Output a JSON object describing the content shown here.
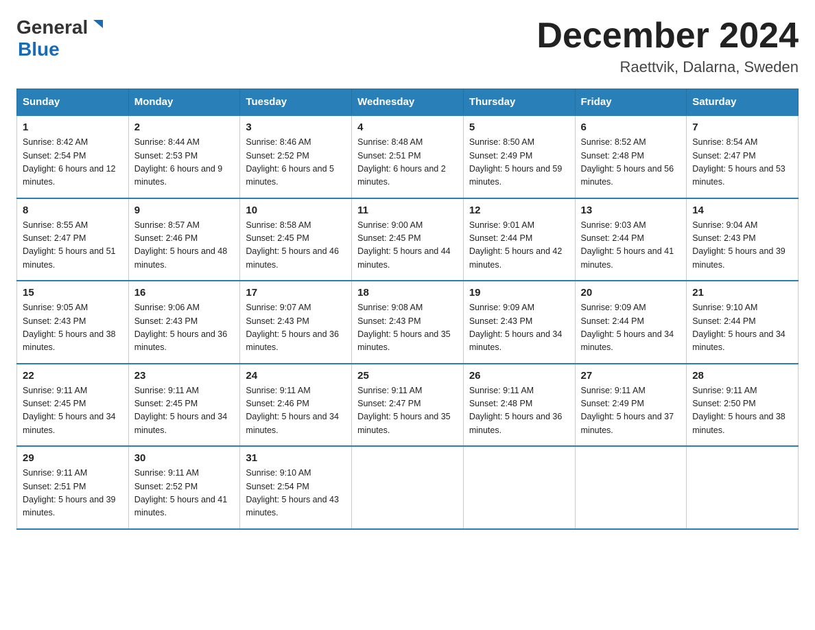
{
  "header": {
    "logo_general": "General",
    "logo_blue": "Blue",
    "month_title": "December 2024",
    "location": "Raettvik, Dalarna, Sweden"
  },
  "days_of_week": [
    "Sunday",
    "Monday",
    "Tuesday",
    "Wednesday",
    "Thursday",
    "Friday",
    "Saturday"
  ],
  "weeks": [
    [
      {
        "day": "1",
        "sunrise": "8:42 AM",
        "sunset": "2:54 PM",
        "daylight": "6 hours and 12 minutes."
      },
      {
        "day": "2",
        "sunrise": "8:44 AM",
        "sunset": "2:53 PM",
        "daylight": "6 hours and 9 minutes."
      },
      {
        "day": "3",
        "sunrise": "8:46 AM",
        "sunset": "2:52 PM",
        "daylight": "6 hours and 5 minutes."
      },
      {
        "day": "4",
        "sunrise": "8:48 AM",
        "sunset": "2:51 PM",
        "daylight": "6 hours and 2 minutes."
      },
      {
        "day": "5",
        "sunrise": "8:50 AM",
        "sunset": "2:49 PM",
        "daylight": "5 hours and 59 minutes."
      },
      {
        "day": "6",
        "sunrise": "8:52 AM",
        "sunset": "2:48 PM",
        "daylight": "5 hours and 56 minutes."
      },
      {
        "day": "7",
        "sunrise": "8:54 AM",
        "sunset": "2:47 PM",
        "daylight": "5 hours and 53 minutes."
      }
    ],
    [
      {
        "day": "8",
        "sunrise": "8:55 AM",
        "sunset": "2:47 PM",
        "daylight": "5 hours and 51 minutes."
      },
      {
        "day": "9",
        "sunrise": "8:57 AM",
        "sunset": "2:46 PM",
        "daylight": "5 hours and 48 minutes."
      },
      {
        "day": "10",
        "sunrise": "8:58 AM",
        "sunset": "2:45 PM",
        "daylight": "5 hours and 46 minutes."
      },
      {
        "day": "11",
        "sunrise": "9:00 AM",
        "sunset": "2:45 PM",
        "daylight": "5 hours and 44 minutes."
      },
      {
        "day": "12",
        "sunrise": "9:01 AM",
        "sunset": "2:44 PM",
        "daylight": "5 hours and 42 minutes."
      },
      {
        "day": "13",
        "sunrise": "9:03 AM",
        "sunset": "2:44 PM",
        "daylight": "5 hours and 41 minutes."
      },
      {
        "day": "14",
        "sunrise": "9:04 AM",
        "sunset": "2:43 PM",
        "daylight": "5 hours and 39 minutes."
      }
    ],
    [
      {
        "day": "15",
        "sunrise": "9:05 AM",
        "sunset": "2:43 PM",
        "daylight": "5 hours and 38 minutes."
      },
      {
        "day": "16",
        "sunrise": "9:06 AM",
        "sunset": "2:43 PM",
        "daylight": "5 hours and 36 minutes."
      },
      {
        "day": "17",
        "sunrise": "9:07 AM",
        "sunset": "2:43 PM",
        "daylight": "5 hours and 36 minutes."
      },
      {
        "day": "18",
        "sunrise": "9:08 AM",
        "sunset": "2:43 PM",
        "daylight": "5 hours and 35 minutes."
      },
      {
        "day": "19",
        "sunrise": "9:09 AM",
        "sunset": "2:43 PM",
        "daylight": "5 hours and 34 minutes."
      },
      {
        "day": "20",
        "sunrise": "9:09 AM",
        "sunset": "2:44 PM",
        "daylight": "5 hours and 34 minutes."
      },
      {
        "day": "21",
        "sunrise": "9:10 AM",
        "sunset": "2:44 PM",
        "daylight": "5 hours and 34 minutes."
      }
    ],
    [
      {
        "day": "22",
        "sunrise": "9:11 AM",
        "sunset": "2:45 PM",
        "daylight": "5 hours and 34 minutes."
      },
      {
        "day": "23",
        "sunrise": "9:11 AM",
        "sunset": "2:45 PM",
        "daylight": "5 hours and 34 minutes."
      },
      {
        "day": "24",
        "sunrise": "9:11 AM",
        "sunset": "2:46 PM",
        "daylight": "5 hours and 34 minutes."
      },
      {
        "day": "25",
        "sunrise": "9:11 AM",
        "sunset": "2:47 PM",
        "daylight": "5 hours and 35 minutes."
      },
      {
        "day": "26",
        "sunrise": "9:11 AM",
        "sunset": "2:48 PM",
        "daylight": "5 hours and 36 minutes."
      },
      {
        "day": "27",
        "sunrise": "9:11 AM",
        "sunset": "2:49 PM",
        "daylight": "5 hours and 37 minutes."
      },
      {
        "day": "28",
        "sunrise": "9:11 AM",
        "sunset": "2:50 PM",
        "daylight": "5 hours and 38 minutes."
      }
    ],
    [
      {
        "day": "29",
        "sunrise": "9:11 AM",
        "sunset": "2:51 PM",
        "daylight": "5 hours and 39 minutes."
      },
      {
        "day": "30",
        "sunrise": "9:11 AM",
        "sunset": "2:52 PM",
        "daylight": "5 hours and 41 minutes."
      },
      {
        "day": "31",
        "sunrise": "9:10 AM",
        "sunset": "2:54 PM",
        "daylight": "5 hours and 43 minutes."
      },
      null,
      null,
      null,
      null
    ]
  ],
  "labels": {
    "sunrise": "Sunrise:",
    "sunset": "Sunset:",
    "daylight": "Daylight:"
  }
}
